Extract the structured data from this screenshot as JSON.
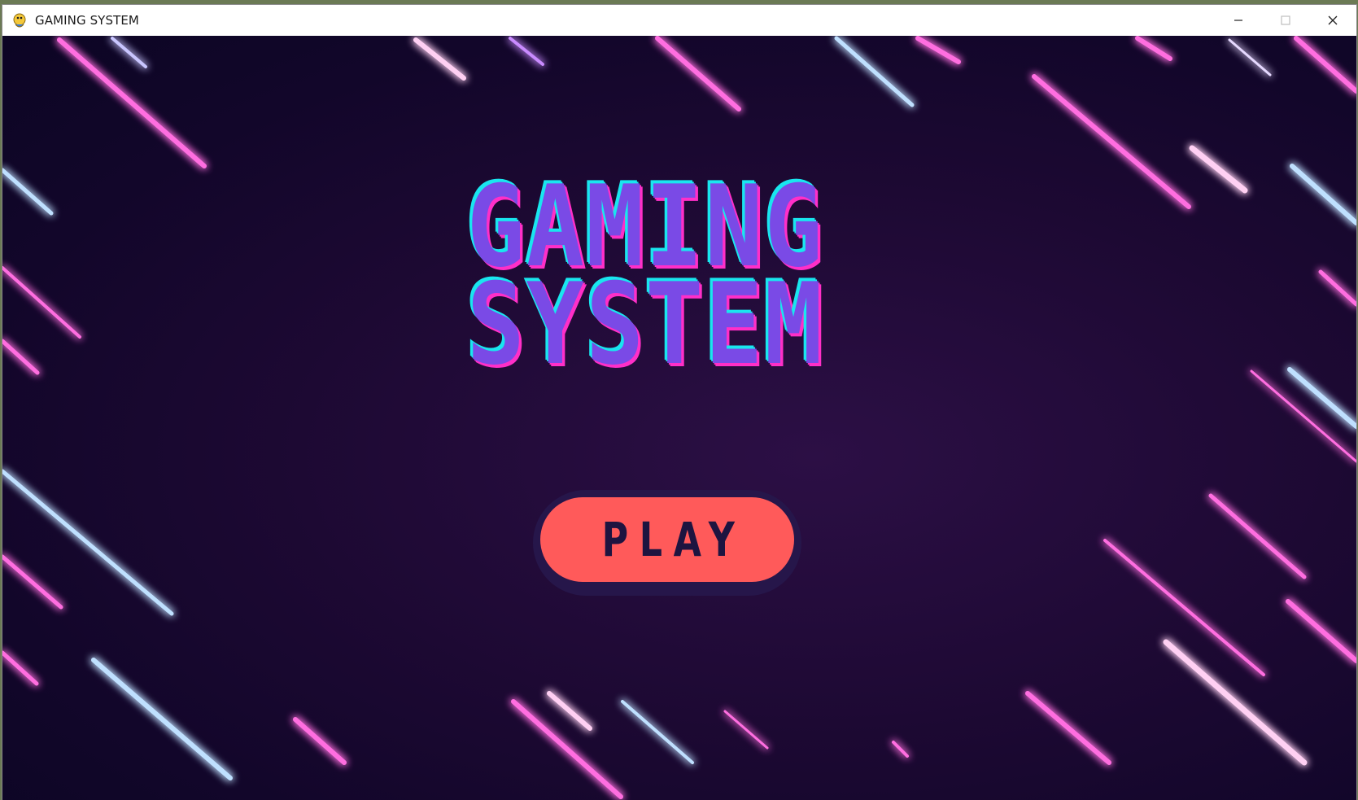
{
  "window": {
    "title": "GAMING SYSTEM",
    "icons": {
      "app": "pygame-snake-icon",
      "minimize": "minimize-icon",
      "maximize": "maximize-icon",
      "close": "close-icon"
    }
  },
  "game": {
    "title_line1": "GAMING",
    "title_line2": "SYSTEM",
    "play_label": "PLAY"
  },
  "colors": {
    "background": "#1a0730",
    "title_fill": "#7a4ae6",
    "title_outline_cyan": "#19e6ef",
    "title_outline_pink": "#ff2fc8",
    "button": "#ff5a5a",
    "button_shadow": "#26164a",
    "button_text": "#1e1440",
    "neon_pink": "#ff4fd8",
    "neon_blue": "#b9d8ff"
  }
}
